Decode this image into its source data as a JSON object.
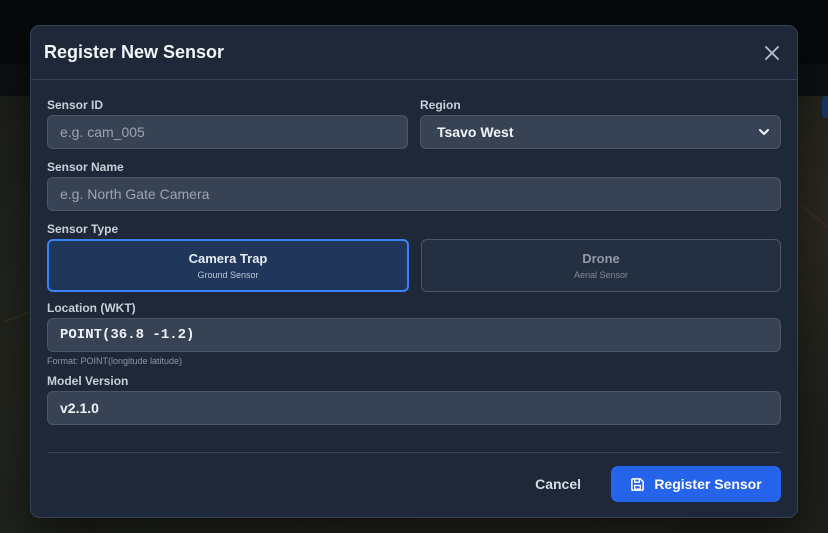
{
  "modal": {
    "title": "Register New Sensor"
  },
  "fields": {
    "sensor_id": {
      "label": "Sensor ID",
      "placeholder": "e.g. cam_005"
    },
    "region": {
      "label": "Region",
      "value": "Tsavo West"
    },
    "sensor_name": {
      "label": "Sensor Name",
      "placeholder": "e.g. North Gate Camera"
    },
    "sensor_type": {
      "label": "Sensor Type",
      "options": [
        {
          "title": "Camera Trap",
          "subtitle": "Ground Sensor",
          "selected": true
        },
        {
          "title": "Drone",
          "subtitle": "Aerial Sensor",
          "selected": false
        }
      ]
    },
    "location": {
      "label": "Location (WKT)",
      "value": "POINT(36.8 -1.2)",
      "hint": "Format: POINT(longitude latitude)"
    },
    "model_version": {
      "label": "Model Version",
      "value": "v2.1.0"
    }
  },
  "footer": {
    "cancel_label": "Cancel",
    "submit_label": "Register Sensor"
  },
  "icons": {
    "close": "close-icon",
    "select": "chevron-down-icon",
    "submit": "save-icon"
  },
  "colors": {
    "accent": "#2563eb",
    "selected_border": "#3b82f6",
    "modal_bg": "#1e2838"
  }
}
